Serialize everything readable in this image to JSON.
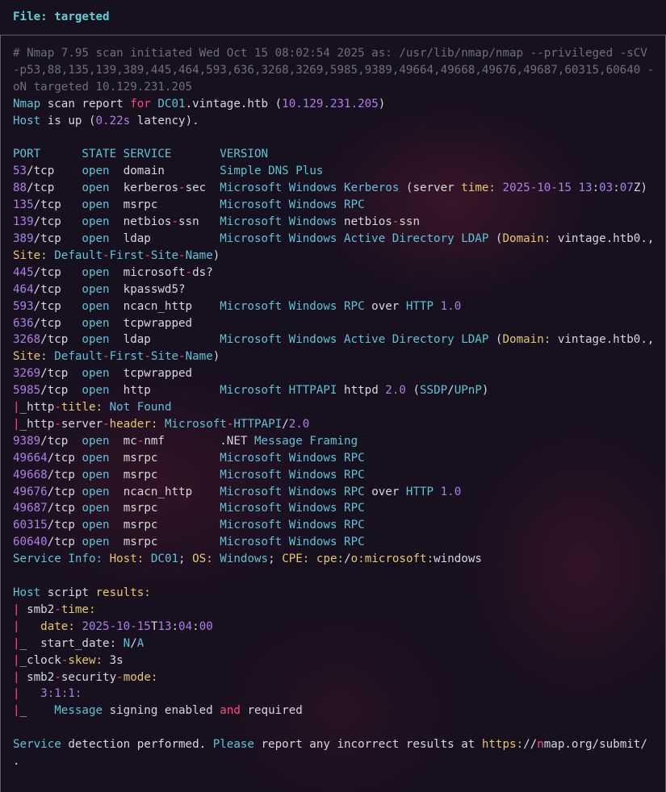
{
  "header": {
    "file_label": "File: targeted"
  },
  "lines": [
    [
      [
        "c-comment",
        "# Nmap 7.95 scan initiated Wed Oct 15 08:02:54 2025 as: /usr/lib/nmap/nmap --privileged -sCV -p53,88,135,139,389,445,464,593,636,3268,3269,5985,9389,49664,49668,49676,49687,60315,60640 -oN targeted 10.129.231.205"
      ]
    ],
    [
      [
        "c-cyan",
        "Nmap"
      ],
      [
        "c-white",
        " scan report "
      ],
      [
        "c-red",
        "for"
      ],
      [
        "c-white",
        " "
      ],
      [
        "c-cyan",
        "DC01"
      ],
      [
        "c-white",
        ".vintage.htb ("
      ],
      [
        "c-purple",
        "10.129.231.205"
      ],
      [
        "c-white",
        ")"
      ]
    ],
    [
      [
        "c-cyan",
        "Host"
      ],
      [
        "c-white",
        " is up ("
      ],
      [
        "c-purple",
        "0.22s"
      ],
      [
        "c-white",
        " latency)."
      ]
    ],
    [
      [
        "c-white",
        ""
      ]
    ],
    [
      [
        "c-cyan",
        "PORT      STATE SERVICE       VERSION"
      ]
    ],
    [
      [
        "c-purple",
        "53"
      ],
      [
        "c-white",
        "/tcp    "
      ],
      [
        "c-cyan",
        "open"
      ],
      [
        "c-white",
        "  domain        "
      ],
      [
        "c-cyan",
        "Simple DNS Plus"
      ]
    ],
    [
      [
        "c-purple",
        "88"
      ],
      [
        "c-white",
        "/tcp    "
      ],
      [
        "c-cyan",
        "open"
      ],
      [
        "c-white",
        "  kerberos"
      ],
      [
        "c-red",
        "-"
      ],
      [
        "c-white",
        "sec  "
      ],
      [
        "c-cyan",
        "Microsoft Windows Kerberos"
      ],
      [
        "c-white",
        " (server "
      ],
      [
        "c-yellow",
        "time:"
      ],
      [
        "c-white",
        " "
      ],
      [
        "c-purple",
        "2025-10-15"
      ],
      [
        "c-white",
        " "
      ],
      [
        "c-purple",
        "13"
      ],
      [
        "c-white",
        ":"
      ],
      [
        "c-purple",
        "03"
      ],
      [
        "c-white",
        ":"
      ],
      [
        "c-purple",
        "07"
      ],
      [
        "c-white",
        "Z)"
      ]
    ],
    [
      [
        "c-purple",
        "135"
      ],
      [
        "c-white",
        "/tcp   "
      ],
      [
        "c-cyan",
        "open"
      ],
      [
        "c-white",
        "  msrpc         "
      ],
      [
        "c-cyan",
        "Microsoft Windows RPC"
      ]
    ],
    [
      [
        "c-purple",
        "139"
      ],
      [
        "c-white",
        "/tcp   "
      ],
      [
        "c-cyan",
        "open"
      ],
      [
        "c-white",
        "  netbios"
      ],
      [
        "c-red",
        "-"
      ],
      [
        "c-white",
        "ssn   "
      ],
      [
        "c-cyan",
        "Microsoft Windows"
      ],
      [
        "c-white",
        " netbios"
      ],
      [
        "c-red",
        "-"
      ],
      [
        "c-white",
        "ssn"
      ]
    ],
    [
      [
        "c-purple",
        "389"
      ],
      [
        "c-white",
        "/tcp   "
      ],
      [
        "c-cyan",
        "open"
      ],
      [
        "c-white",
        "  ldap          "
      ],
      [
        "c-cyan",
        "Microsoft Windows Active Directory LDAP"
      ],
      [
        "c-white",
        " ("
      ],
      [
        "c-yellow",
        "Domain:"
      ],
      [
        "c-white",
        " vintage.htb0., "
      ],
      [
        "c-yellow",
        "Site:"
      ],
      [
        "c-white",
        " "
      ],
      [
        "c-cyan",
        "Default"
      ],
      [
        "c-red",
        "-"
      ],
      [
        "c-cyan",
        "First"
      ],
      [
        "c-red",
        "-"
      ],
      [
        "c-cyan",
        "Site"
      ],
      [
        "c-red",
        "-"
      ],
      [
        "c-cyan",
        "Name"
      ],
      [
        "c-white",
        ")"
      ]
    ],
    [
      [
        "c-purple",
        "445"
      ],
      [
        "c-white",
        "/tcp   "
      ],
      [
        "c-cyan",
        "open"
      ],
      [
        "c-white",
        "  microsoft"
      ],
      [
        "c-red",
        "-"
      ],
      [
        "c-white",
        "ds?"
      ]
    ],
    [
      [
        "c-purple",
        "464"
      ],
      [
        "c-white",
        "/tcp   "
      ],
      [
        "c-cyan",
        "open"
      ],
      [
        "c-white",
        "  kpasswd5?"
      ]
    ],
    [
      [
        "c-purple",
        "593"
      ],
      [
        "c-white",
        "/tcp   "
      ],
      [
        "c-cyan",
        "open"
      ],
      [
        "c-white",
        "  ncacn_http    "
      ],
      [
        "c-cyan",
        "Microsoft Windows RPC"
      ],
      [
        "c-white",
        " over "
      ],
      [
        "c-cyan",
        "HTTP"
      ],
      [
        "c-white",
        " "
      ],
      [
        "c-purple",
        "1.0"
      ]
    ],
    [
      [
        "c-purple",
        "636"
      ],
      [
        "c-white",
        "/tcp   "
      ],
      [
        "c-cyan",
        "open"
      ],
      [
        "c-white",
        "  tcpwrapped"
      ]
    ],
    [
      [
        "c-purple",
        "3268"
      ],
      [
        "c-white",
        "/tcp  "
      ],
      [
        "c-cyan",
        "open"
      ],
      [
        "c-white",
        "  ldap          "
      ],
      [
        "c-cyan",
        "Microsoft Windows Active Directory LDAP"
      ],
      [
        "c-white",
        " ("
      ],
      [
        "c-yellow",
        "Domain:"
      ],
      [
        "c-white",
        " vintage.htb0., "
      ],
      [
        "c-yellow",
        "Site:"
      ],
      [
        "c-white",
        " "
      ],
      [
        "c-cyan",
        "Default"
      ],
      [
        "c-red",
        "-"
      ],
      [
        "c-cyan",
        "First"
      ],
      [
        "c-red",
        "-"
      ],
      [
        "c-cyan",
        "Site"
      ],
      [
        "c-red",
        "-"
      ],
      [
        "c-cyan",
        "Name"
      ],
      [
        "c-white",
        ")"
      ]
    ],
    [
      [
        "c-purple",
        "3269"
      ],
      [
        "c-white",
        "/tcp  "
      ],
      [
        "c-cyan",
        "open"
      ],
      [
        "c-white",
        "  tcpwrapped"
      ]
    ],
    [
      [
        "c-purple",
        "5985"
      ],
      [
        "c-white",
        "/tcp  "
      ],
      [
        "c-cyan",
        "open"
      ],
      [
        "c-white",
        "  http          "
      ],
      [
        "c-cyan",
        "Microsoft HTTPAPI"
      ],
      [
        "c-white",
        " httpd "
      ],
      [
        "c-purple",
        "2.0"
      ],
      [
        "c-white",
        " ("
      ],
      [
        "c-cyan",
        "SSDP"
      ],
      [
        "c-white",
        "/"
      ],
      [
        "c-cyan",
        "UPnP"
      ],
      [
        "c-white",
        ")"
      ]
    ],
    [
      [
        "c-red",
        "|"
      ],
      [
        "c-white",
        "_http"
      ],
      [
        "c-red",
        "-"
      ],
      [
        "c-yellow",
        "title:"
      ],
      [
        "c-white",
        " "
      ],
      [
        "c-cyan",
        "Not Found"
      ]
    ],
    [
      [
        "c-red",
        "|"
      ],
      [
        "c-white",
        "_http"
      ],
      [
        "c-red",
        "-"
      ],
      [
        "c-white",
        "server"
      ],
      [
        "c-red",
        "-"
      ],
      [
        "c-yellow",
        "header:"
      ],
      [
        "c-white",
        " "
      ],
      [
        "c-cyan",
        "Microsoft"
      ],
      [
        "c-red",
        "-"
      ],
      [
        "c-cyan",
        "HTTPAPI"
      ],
      [
        "c-white",
        "/"
      ],
      [
        "c-purple",
        "2.0"
      ]
    ],
    [
      [
        "c-purple",
        "9389"
      ],
      [
        "c-white",
        "/tcp  "
      ],
      [
        "c-cyan",
        "open"
      ],
      [
        "c-white",
        "  mc"
      ],
      [
        "c-red",
        "-"
      ],
      [
        "c-white",
        "nmf        .NET "
      ],
      [
        "c-cyan",
        "Message Framing"
      ]
    ],
    [
      [
        "c-purple",
        "49664"
      ],
      [
        "c-white",
        "/tcp "
      ],
      [
        "c-cyan",
        "open"
      ],
      [
        "c-white",
        "  msrpc         "
      ],
      [
        "c-cyan",
        "Microsoft Windows RPC"
      ]
    ],
    [
      [
        "c-purple",
        "49668"
      ],
      [
        "c-white",
        "/tcp "
      ],
      [
        "c-cyan",
        "open"
      ],
      [
        "c-white",
        "  msrpc         "
      ],
      [
        "c-cyan",
        "Microsoft Windows RPC"
      ]
    ],
    [
      [
        "c-purple",
        "49676"
      ],
      [
        "c-white",
        "/tcp "
      ],
      [
        "c-cyan",
        "open"
      ],
      [
        "c-white",
        "  ncacn_http    "
      ],
      [
        "c-cyan",
        "Microsoft Windows RPC"
      ],
      [
        "c-white",
        " over "
      ],
      [
        "c-cyan",
        "HTTP"
      ],
      [
        "c-white",
        " "
      ],
      [
        "c-purple",
        "1.0"
      ]
    ],
    [
      [
        "c-purple",
        "49687"
      ],
      [
        "c-white",
        "/tcp "
      ],
      [
        "c-cyan",
        "open"
      ],
      [
        "c-white",
        "  msrpc         "
      ],
      [
        "c-cyan",
        "Microsoft Windows RPC"
      ]
    ],
    [
      [
        "c-purple",
        "60315"
      ],
      [
        "c-white",
        "/tcp "
      ],
      [
        "c-cyan",
        "open"
      ],
      [
        "c-white",
        "  msrpc         "
      ],
      [
        "c-cyan",
        "Microsoft Windows RPC"
      ]
    ],
    [
      [
        "c-purple",
        "60640"
      ],
      [
        "c-white",
        "/tcp "
      ],
      [
        "c-cyan",
        "open"
      ],
      [
        "c-white",
        "  msrpc         "
      ],
      [
        "c-cyan",
        "Microsoft Windows RPC"
      ]
    ],
    [
      [
        "c-cyan",
        "Service Info:"
      ],
      [
        "c-white",
        " "
      ],
      [
        "c-yellow",
        "Host:"
      ],
      [
        "c-white",
        " "
      ],
      [
        "c-cyan",
        "DC01"
      ],
      [
        "c-white",
        "; "
      ],
      [
        "c-yellow",
        "OS:"
      ],
      [
        "c-white",
        " "
      ],
      [
        "c-cyan",
        "Windows"
      ],
      [
        "c-white",
        "; "
      ],
      [
        "c-yellow",
        "CPE:"
      ],
      [
        "c-white",
        " "
      ],
      [
        "c-yellow",
        "cpe:"
      ],
      [
        "c-white",
        "/"
      ],
      [
        "c-yellow",
        "o:microsoft:"
      ],
      [
        "c-white",
        "windows"
      ]
    ],
    [
      [
        "c-white",
        ""
      ]
    ],
    [
      [
        "c-cyan",
        "Host"
      ],
      [
        "c-white",
        " script "
      ],
      [
        "c-yellow",
        "results:"
      ]
    ],
    [
      [
        "c-red",
        "|"
      ],
      [
        "c-white",
        " smb2"
      ],
      [
        "c-red",
        "-"
      ],
      [
        "c-yellow",
        "time:"
      ]
    ],
    [
      [
        "c-red",
        "|"
      ],
      [
        "c-white",
        "   "
      ],
      [
        "c-yellow",
        "date:"
      ],
      [
        "c-white",
        " "
      ],
      [
        "c-purple",
        "2025-10-15"
      ],
      [
        "c-white",
        "T"
      ],
      [
        "c-purple",
        "13"
      ],
      [
        "c-white",
        ":"
      ],
      [
        "c-purple",
        "04"
      ],
      [
        "c-white",
        ":"
      ],
      [
        "c-purple",
        "00"
      ]
    ],
    [
      [
        "c-red",
        "|"
      ],
      [
        "c-white",
        "_  start_date: "
      ],
      [
        "c-cyan",
        "N"
      ],
      [
        "c-white",
        "/"
      ],
      [
        "c-cyan",
        "A"
      ]
    ],
    [
      [
        "c-red",
        "|"
      ],
      [
        "c-white",
        "_clock"
      ],
      [
        "c-red",
        "-"
      ],
      [
        "c-yellow",
        "skew:"
      ],
      [
        "c-white",
        " 3s"
      ]
    ],
    [
      [
        "c-red",
        "|"
      ],
      [
        "c-white",
        " smb2"
      ],
      [
        "c-red",
        "-"
      ],
      [
        "c-white",
        "security"
      ],
      [
        "c-red",
        "-"
      ],
      [
        "c-yellow",
        "mode:"
      ]
    ],
    [
      [
        "c-red",
        "|"
      ],
      [
        "c-white",
        "   "
      ],
      [
        "c-purple",
        "3:1:1:"
      ]
    ],
    [
      [
        "c-red",
        "|"
      ],
      [
        "c-white",
        "_    "
      ],
      [
        "c-cyan",
        "Message"
      ],
      [
        "c-white",
        " signing enabled "
      ],
      [
        "c-red",
        "and"
      ],
      [
        "c-white",
        " required"
      ]
    ],
    [
      [
        "c-white",
        ""
      ]
    ],
    [
      [
        "c-cyan",
        "Service"
      ],
      [
        "c-white",
        " detection performed. "
      ],
      [
        "c-cyan",
        "Please"
      ],
      [
        "c-white",
        " report any incorrect results at "
      ],
      [
        "c-yellow",
        "https:"
      ],
      [
        "c-white",
        "//"
      ],
      [
        "c-red",
        "n"
      ],
      [
        "c-white",
        "map.org/submit/ ."
      ]
    ]
  ]
}
